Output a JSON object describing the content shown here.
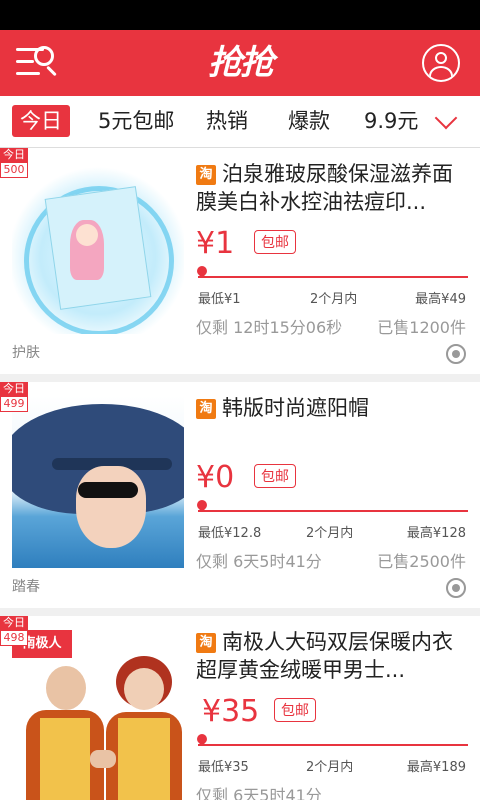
{
  "header": {
    "logo": "抢抢"
  },
  "tabs": [
    {
      "label": "今日",
      "active": true
    },
    {
      "label": "5元包邮"
    },
    {
      "label": "热销"
    },
    {
      "label": "爆款"
    },
    {
      "label": "9.9元"
    }
  ],
  "colors": {
    "accent": "#e8343f",
    "taobao": "#f07a12"
  },
  "products": [
    {
      "badge_top": "今日",
      "badge_num": "500",
      "platform_icon": "淘",
      "title": "泊泉雅玻尿酸保湿滋养面膜美白补水控油祛痘印...",
      "price": "¥1",
      "ship": "包邮",
      "low": "最低¥1",
      "mid": "2个月内",
      "high": "最高¥49",
      "remain": "仅剩 12时15分06秒",
      "sold": "已售1200件",
      "category": "护肤"
    },
    {
      "badge_top": "今日",
      "badge_num": "499",
      "platform_icon": "淘",
      "title": "韩版时尚遮阳帽",
      "price": "¥0",
      "ship": "包邮",
      "low": "最低¥12.8",
      "mid": "2个月内",
      "high": "最高¥128",
      "remain": "仅剩 6天5时41分",
      "sold": "已售2500件",
      "category": "踏春"
    },
    {
      "badge_top": "今日",
      "badge_num": "498",
      "platform_icon": "淘",
      "brand_text": "南极人",
      "title": "南极人大码双层保暖内衣超厚黄金绒暖甲男士...",
      "price": "¥35",
      "ship": "包邮",
      "low": "最低¥35",
      "mid": "2个月内",
      "high": "最高¥189",
      "remain": "仅剩 6天5时41分",
      "sold": "",
      "category": ""
    }
  ]
}
